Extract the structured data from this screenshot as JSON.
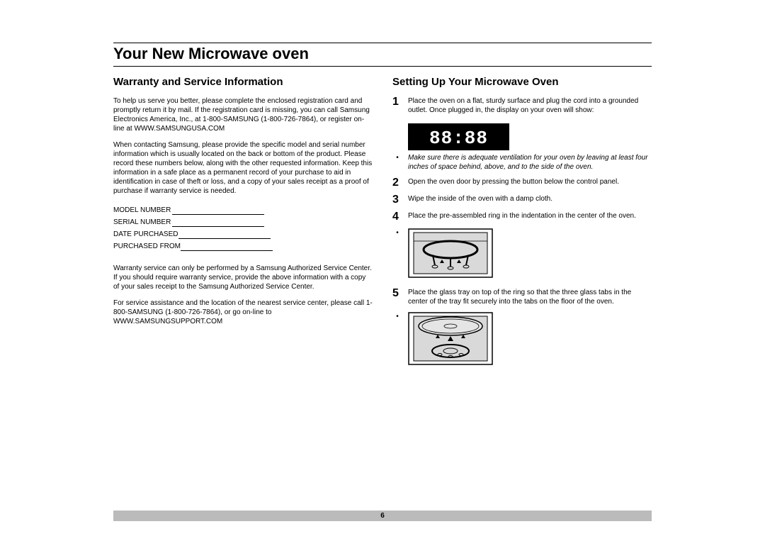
{
  "page": {
    "title": "Your New Microwave oven",
    "number": "6"
  },
  "left": {
    "heading": "Warranty and Service Information",
    "p1": "To help us serve you better, please complete the enclosed registration card and promptly return it by mail.  If the registration card is missing, you can call Samsung Electronics America, Inc., at 1-800-SAMSUNG (1-800-726-7864), or register on-line at WWW.SAMSUNGUSA.COM",
    "p2": "When contacting Samsung, please provide the specific model and serial number information which is usually located on the back or bottom of the product.  Please record these numbers below, along with the other requested information. Keep this information in a safe place as a permanent record of your purchase to aid in identification in case of theft or loss, and a copy of your sales receipt as a proof of purchase if warranty service is needed.",
    "fields": {
      "model": "MODEL NUMBER",
      "serial": "SERIAL NUMBER",
      "date": "DATE PURCHASED",
      "from": "PURCHASED FROM"
    },
    "p3": "Warranty service can only be performed by a Samsung Authorized Service Center.  If you should require warranty service, provide the above information with a copy of your sales receipt to the Samsung Authorized Service Center.",
    "p4": "For service assistance and the location of the nearest service center, please call 1-800-SAMSUNG (1-800-726-7864), or go on-line to WWW.SAMSUNGSUPPORT.COM"
  },
  "right": {
    "heading": "Setting Up Your Microwave Oven",
    "step1": "Place the oven on a flat, sturdy surface and plug the cord into a grounded outlet.  Once plugged in, the display on your oven will show:",
    "display": "88:88",
    "note": "Make sure there is adequate ventilation for your oven by leaving at least four inches of space behind, above, and to the side of the oven.",
    "step2": "Open the oven door by pressing the button below the control panel.",
    "step3": "Wipe the inside of the oven with a damp cloth.",
    "step4": "Place the pre-assembled ring in the indentation in the center of the oven.",
    "step5": "Place the glass tray on top of the ring so that the three glass tabs in the center of the tray fit securely into the tabs on the floor of the oven."
  }
}
